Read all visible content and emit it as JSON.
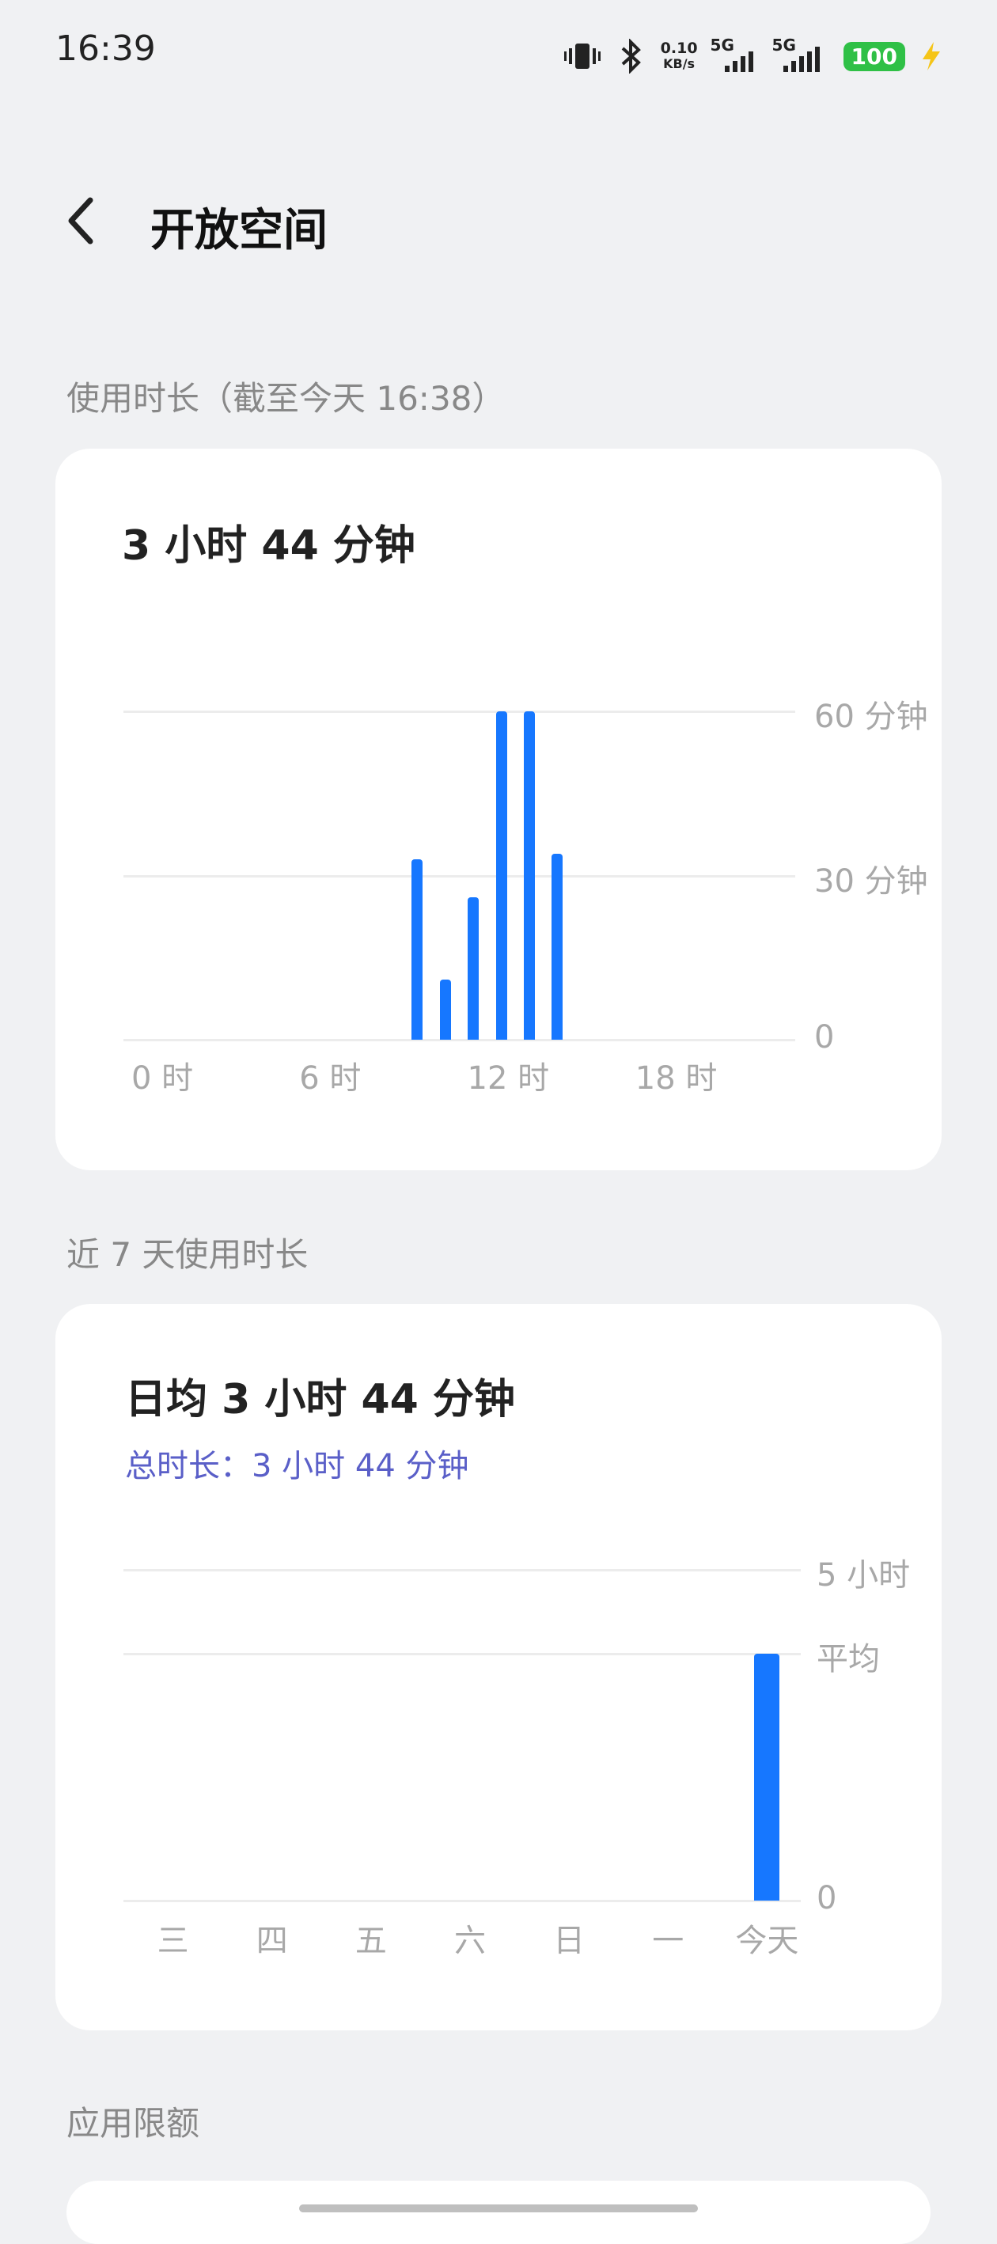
{
  "status_bar": {
    "time": "16:39",
    "net_speed_value": "0.10",
    "net_speed_unit": "KB/s",
    "sim1": "5G",
    "sim2": "5G",
    "battery": "100",
    "icons": [
      "vibrate-icon",
      "bluetooth-icon",
      "signal-icon",
      "signal-icon",
      "battery-icon",
      "charging-icon"
    ]
  },
  "header": {
    "title": "开放空间",
    "back_icon": "chevron-left-icon"
  },
  "today": {
    "section_title": "使用时长（截至今天 16:38）",
    "total": "3 小时 44 分钟",
    "chart_data": {
      "type": "bar",
      "x_unit": "hour",
      "x": [
        10,
        11,
        12,
        13,
        14,
        15
      ],
      "values": [
        33,
        11,
        26,
        60,
        60,
        34
      ],
      "xlim": [
        0,
        23
      ],
      "ylim": [
        0,
        60
      ],
      "y_ticks": [
        "0",
        "30 分钟",
        "60 分钟"
      ],
      "x_ticks": [
        "0 时",
        "6 时",
        "12 时",
        "18 时"
      ],
      "color": "#1677ff"
    }
  },
  "week": {
    "section_title": "近 7 天使用时长",
    "avg": "日均 3 小时 44 分钟",
    "total": "总时长：3 小时 44 分钟",
    "chart_data": {
      "type": "bar",
      "categories": [
        "三",
        "四",
        "五",
        "六",
        "日",
        "一",
        "今天"
      ],
      "values": [
        0,
        0,
        0,
        0,
        0,
        0,
        3.73
      ],
      "ylim": [
        0,
        5
      ],
      "y_ticks": [
        "0",
        "平均",
        "5 小时"
      ],
      "color": "#1677ff"
    }
  },
  "quota": {
    "section_title": "应用限额"
  }
}
